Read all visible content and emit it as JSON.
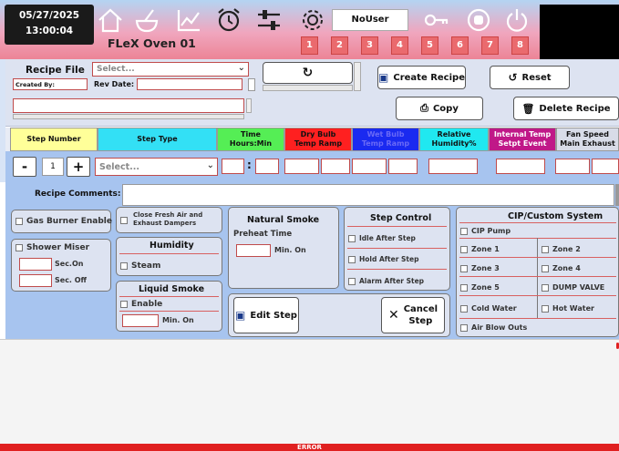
{
  "header": {
    "date": "05/27/2025",
    "time": "13:00:04",
    "oven_name": "FLeX Oven 01",
    "user": "NoUser",
    "slots": [
      "1",
      "2",
      "3",
      "4",
      "5",
      "6",
      "7",
      "8"
    ],
    "nav_icons": [
      "home-icon",
      "mixing-bowl-icon",
      "chart-icon",
      "alarm-clock-icon",
      "sliders-icon",
      "settings-gear-icon",
      "key-icon",
      "stop-hand-icon",
      "power-icon"
    ]
  },
  "recipe": {
    "file_label": "Recipe File",
    "select_placeholder": "Select...",
    "created_by_label": "Created By:",
    "rev_date_label": "Rev Date:",
    "create_label": "Create Recipe",
    "reset_label": "Reset",
    "copy_label": "Copy",
    "delete_label": "Delete Recipe"
  },
  "step_header": {
    "step_number": "Step Number",
    "step_type": "Step Type",
    "time_1": "Time",
    "time_2": "Hours:Min",
    "dry_1": "Dry Bulb",
    "dry_2": "Temp   Ramp",
    "wet_1": "Wet Bulb",
    "wet_2": "Temp   Ramp",
    "rh_1": "Relative",
    "rh_2": "Humidity%",
    "int_1": "Internal Temp",
    "int_2": "Setpt Event",
    "fan_1": "Fan Speed",
    "fan_2": "Main Exhaust",
    "colors": {
      "yellow": "#ffff99",
      "cyan": "#33e0f5",
      "green": "#55ee55",
      "red": "#ff2020",
      "blue": "#1a2af0",
      "teal": "#20e8f0",
      "purple": "#c01888",
      "gray": "#d8dce8"
    }
  },
  "step_row": {
    "minus": "-",
    "step_value": "1",
    "plus": "+",
    "select_placeholder": "Select...",
    "time_sep": ":"
  },
  "comments_label": "Recipe Comments:",
  "options": {
    "gas_burner": "Gas Burner Enable",
    "fresh_air_1": "Close Fresh Air and",
    "fresh_air_2": "Exhaust Dampers",
    "shower_title": "Shower Miser",
    "sec_on": "Sec.On",
    "sec_off": "Sec. Off",
    "humidity_title": "Humidity",
    "steam": "Steam",
    "liquid_title": "Liquid Smoke",
    "enable": "Enable",
    "min_on": "Min. On",
    "natural_title": "Natural Smoke",
    "preheat": "Preheat Time",
    "nat_min_on": "Min. On",
    "step_control_title": "Step Control",
    "idle_after": "Idle After Step",
    "hold_after": "Hold After Step",
    "alarm_after": "Alarm After Step",
    "edit_step": "Edit Step",
    "cancel_1": "Cancel",
    "cancel_2": "Step",
    "cip_title": "CIP/Custom System",
    "cip_pump": "CIP Pump",
    "zone1": "Zone 1",
    "zone2": "Zone 2",
    "zone3": "Zone 3",
    "zone4": "Zone 4",
    "zone5": "Zone 5",
    "dump_valve": "DUMP VALVE",
    "cold_water": "Cold Water",
    "hot_water": "Hot Water",
    "air_blow": "Air Blow Outs"
  },
  "footer": {
    "error": "ERROR"
  }
}
